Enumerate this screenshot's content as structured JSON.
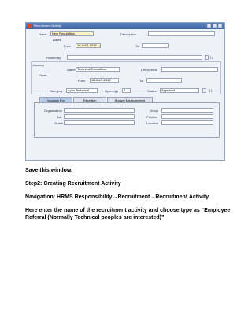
{
  "window": {
    "title": "Recruitment Activity",
    "ctrl_labels": [
      "minimize",
      "maximize",
      "close"
    ]
  },
  "form": {
    "name_label": "Name",
    "name_value": "New Requisition",
    "description_label": "Description",
    "description_value": "",
    "dates_label": "Dates",
    "from_label": "From",
    "from_value": "16-AUG-2012",
    "to_label": "To",
    "to_value": "",
    "raised_by_label": "Raised By",
    "raised_by_value": ""
  },
  "vacancy": {
    "group_label": "Vacancy",
    "name_label": "Name",
    "name_value": "Technical Consultant",
    "description_label": "Description",
    "description_value": "",
    "dates_label": "Dates",
    "from_label": "From",
    "from_value": "16-AUG-2012",
    "to_label": "To",
    "to_value": "",
    "category_label": "Category",
    "category_value": "Apps Technical",
    "openings_label": "Openings",
    "openings_value": "2",
    "status_label": "Status",
    "status_value": "Approved"
  },
  "tabs": [
    {
      "label": "Vacancy For"
    },
    {
      "label": "Recruiter"
    },
    {
      "label": "Budget Measurement"
    }
  ],
  "tab_fields": {
    "organization_label": "Organization",
    "job_label": "Job",
    "grade_label": "Grade",
    "group_label": "Group",
    "position_label": "Position",
    "location_label": "Location"
  },
  "doc": {
    "line1": "Save this window.",
    "line2": "Step2: Creating Recruitment Activity",
    "line3_prefix": "Navigation: HRMS Responsibility",
    "line3_mid": "Recruitment",
    "line3_end": "Recruitment Activity",
    "arrow": "→",
    "line4": "Here enter the name of the recruitment activity and choose type as “Employee Referral (Normally Technical peoples are interested)”"
  }
}
